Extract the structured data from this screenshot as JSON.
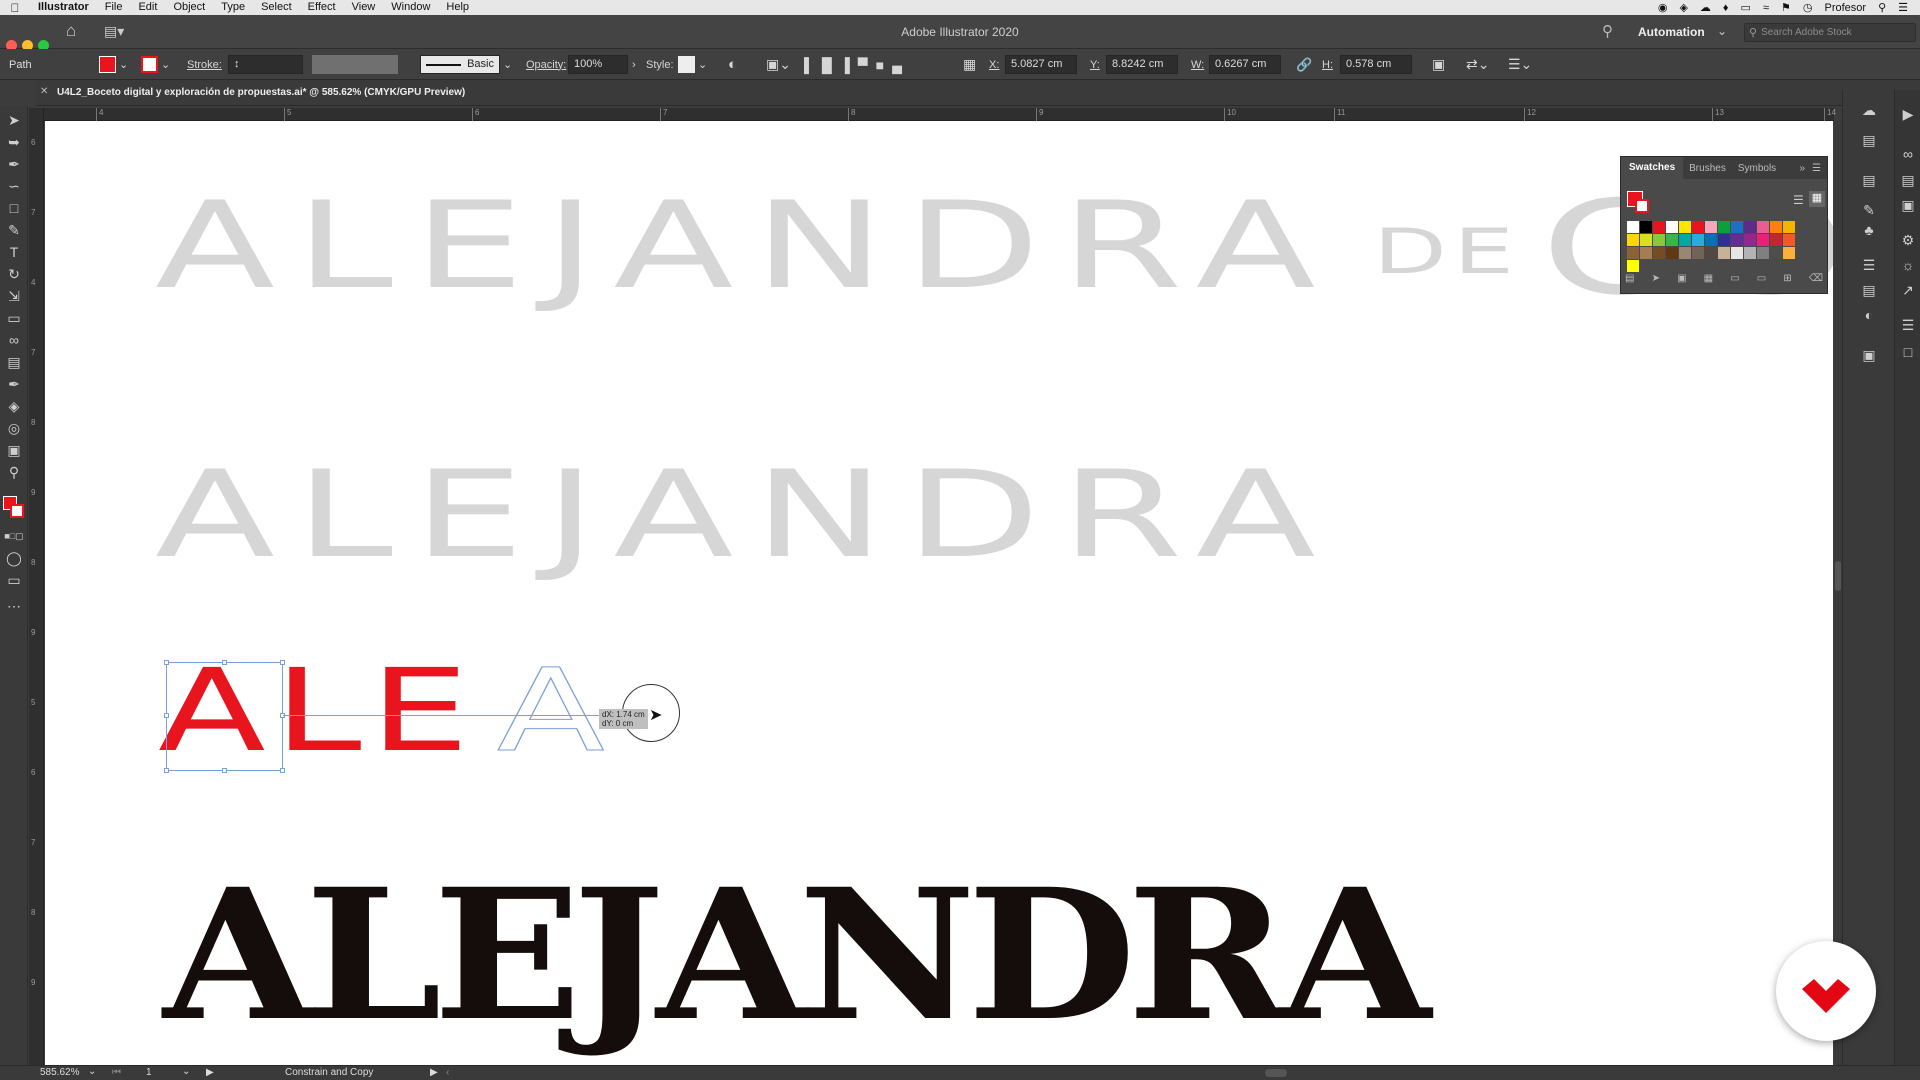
{
  "menubar": {
    "apple": "",
    "items": [
      "Illustrator",
      "File",
      "Edit",
      "Object",
      "Type",
      "Select",
      "Effect",
      "View",
      "Window",
      "Help"
    ],
    "user": "Profesor"
  },
  "titlebar": {
    "title": "Adobe Illustrator 2020",
    "workspace": "Automation",
    "search_placeholder": "Search Adobe Stock"
  },
  "control": {
    "selection": "Path",
    "stroke_label": "Stroke:",
    "brush": "Basic",
    "opacity_label": "Opacity:",
    "opacity": "100%",
    "style_label": "Style:",
    "x_label": "X:",
    "x": "5.0827 cm",
    "y_label": "Y:",
    "y": "8.8242 cm",
    "w_label": "W:",
    "w": "0.6267 cm",
    "h_label": "H:",
    "h": "0.578 cm",
    "fill_color": "#e8141e"
  },
  "doc": {
    "tab_title": "U4L2_Boceto digital y exploración de propuestas.ai* @ 585.62% (CMYK/GPU Preview)"
  },
  "ruler": {
    "h": [
      "4",
      "5",
      "6",
      "7",
      "8",
      "9",
      "10",
      "11",
      "12",
      "13",
      "14"
    ],
    "v": [
      "6",
      "7",
      "4",
      "7",
      "8",
      "9",
      "8",
      "9",
      "5",
      "6",
      "7",
      "8",
      "9"
    ]
  },
  "canvas": {
    "line1": "ALEJANDRA",
    "line1_de": "DE",
    "line1_tail": "CO",
    "line2": "ALEJANDRA",
    "line3_red": "ALE",
    "line3_ghost": "A",
    "line4": "ALEJANDRA",
    "tooltip_dx": "dX: 1.74 cm",
    "tooltip_dy": "dY: 0 cm",
    "accent_red": "#e8141e",
    "selection_blue": "#7aa0d8"
  },
  "swatches": {
    "tabs": [
      "Swatches",
      "Brushes",
      "Symbols"
    ],
    "colors": [
      "#ffffff",
      "#000000",
      "#e8141e",
      "#ffffff",
      "#ffe600",
      "#e8141e",
      "#f7a5c1",
      "#0aa13c",
      "#1f6fc2",
      "#5a2d88",
      "#ea5e8f",
      "#ff7f11",
      "#f6b400",
      "#ffd700",
      "#d9e021",
      "#8cc63f",
      "#39b54a",
      "#00a99d",
      "#29abe2",
      "#0071bc",
      "#2e3192",
      "#662d91",
      "#93278f",
      "#ed1e79",
      "#c1272d",
      "#f15a24",
      "#8c6239",
      "#a67c52",
      "#754c24",
      "#603813",
      "#998675",
      "#736357",
      "#534741",
      "#c7b299",
      "#e6e6e6",
      "#b3b3b3",
      "#808080",
      "#4d4d4d",
      "#fbb03b",
      "#ffff00"
    ]
  },
  "status": {
    "zoom": "585.62%",
    "page": "1",
    "tool_hint": "Constrain and Copy"
  }
}
